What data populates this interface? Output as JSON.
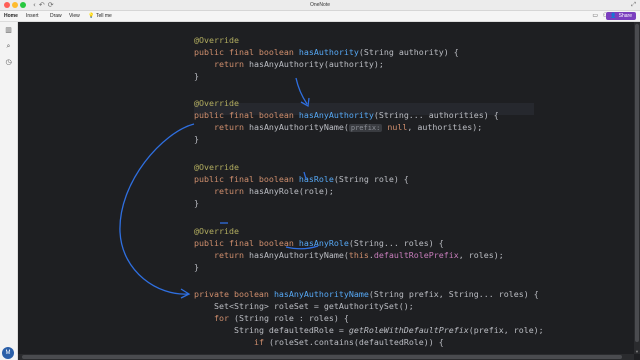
{
  "window": {
    "app_title": "OneNote",
    "toolbar_icons": [
      "back-icon",
      "undo-icon",
      "sync-icon"
    ]
  },
  "ribbon": {
    "menu": [
      "Home",
      "Insert",
      "Draw",
      "View",
      "Tell me"
    ],
    "tell_me_icon": "lightbulb-icon",
    "share_label": "Share",
    "right_icons": [
      "comment-icon",
      "share-people-icon"
    ]
  },
  "sidebar": {
    "icons": [
      "notebooks-icon",
      "search-icon",
      "recent-icon"
    ],
    "avatar_initial": "M"
  },
  "colors": {
    "background": "#1e1f22",
    "keyword": "#cf8e6d",
    "annotation": "#b3ae60",
    "method": "#56a8f5",
    "field": "#c77dbb",
    "ink": "#2f6fe0",
    "share_button": "#7b3fbf"
  },
  "code": {
    "l1": {
      "ann": "@Override"
    },
    "l2": {
      "kw": "public final boolean ",
      "fn": "hasAuthority",
      "rest": "(String authority) {"
    },
    "l3": {
      "kw": "return ",
      "rest": "hasAnyAuthority(authority);"
    },
    "l4": {
      "rest": "}"
    },
    "l5": {
      "ann": "@Override"
    },
    "l6": {
      "kw": "public final boolean ",
      "fn": "hasAnyAuthority",
      "rest": "(String... authorities) {"
    },
    "l7": {
      "kw": "return ",
      "rest": "hasAnyAuthorityName(",
      "hint": "prefix:",
      "kw2": " null",
      "rest2": ", authorities);"
    },
    "l8": {
      "rest": "}"
    },
    "l9": {
      "ann": "@Override"
    },
    "l10": {
      "kw": "public final boolean ",
      "fn": "hasRole",
      "rest": "(String role) {"
    },
    "l11": {
      "kw": "return ",
      "rest": "hasAnyRole(role);"
    },
    "l12": {
      "rest": "}"
    },
    "l13": {
      "ann": "@Override"
    },
    "l14": {
      "kw": "public final boolean ",
      "fn": "hasAnyRole",
      "rest": "(String... roles) {"
    },
    "l15": {
      "kw": "return ",
      "rest": "hasAnyAuthorityName(",
      "kw2": "this",
      "rest2": ".",
      "field": "defaultRolePrefix",
      "rest3": ", roles);"
    },
    "l16": {
      "rest": "}"
    },
    "l17": {
      "kw": "private boolean ",
      "fn": "hasAnyAuthorityName",
      "rest": "(String prefix, String... roles) {"
    },
    "l18": {
      "rest": "Set<String> roleSet = getAuthoritySet();"
    },
    "l19": {
      "kw": "for ",
      "rest": "(String role : roles) {"
    },
    "l20": {
      "rest": "String defaultedRole = ",
      "ital": "getRoleWithDefaultPrefix",
      "rest2": "(prefix, role);"
    },
    "l21": {
      "kw": "if ",
      "rest": "(roleSet.contains(defaultedRole)) {"
    }
  }
}
